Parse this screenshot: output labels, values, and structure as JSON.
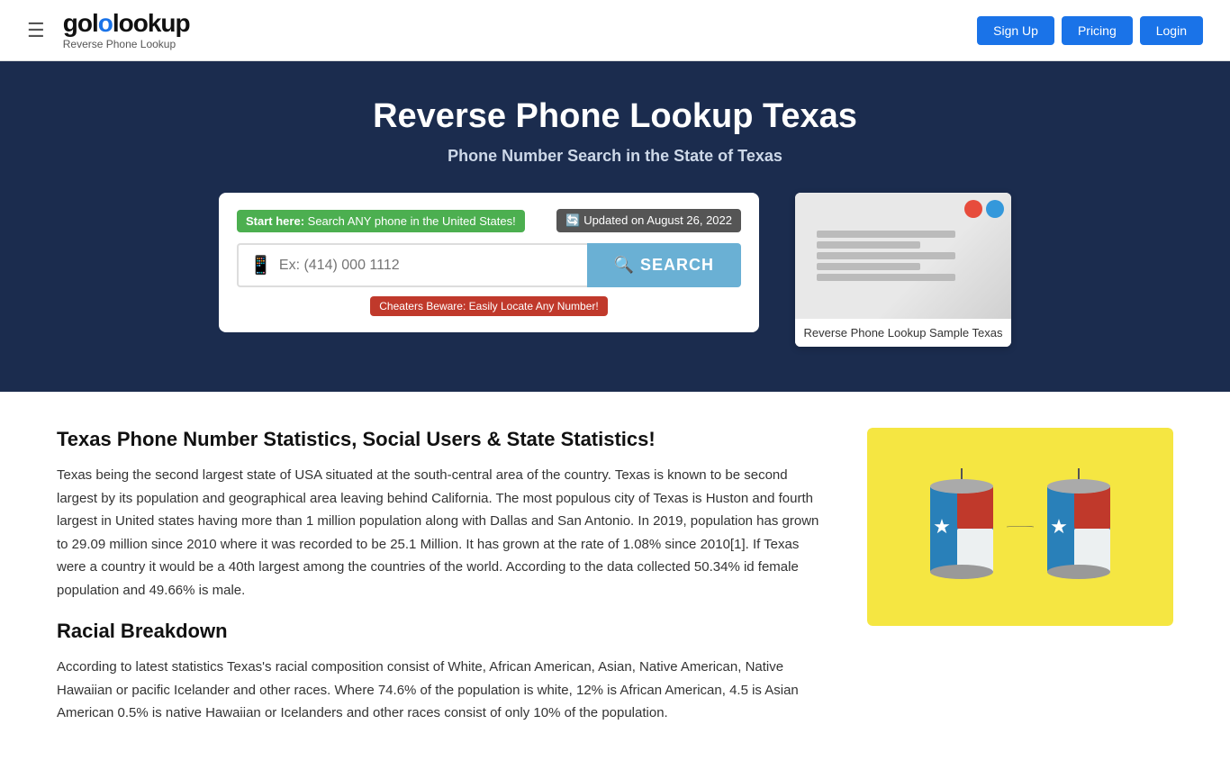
{
  "navbar": {
    "logo_text_go": "go",
    "logo_text_lookup": "lookup",
    "logo_sub": "Reverse Phone Lookup",
    "hamburger_icon": "☰",
    "btn_signup": "Sign Up",
    "btn_pricing": "Pricing",
    "btn_login": "Login"
  },
  "hero": {
    "title": "Reverse Phone Lookup Texas",
    "subtitle": "Phone Number Search in the State of Texas",
    "badge_start_label": "Start here:",
    "badge_start_text": "Search ANY phone in the United States!",
    "badge_updated": "🔄 Updated on August 26, 2022",
    "search_placeholder": "Ex: (414) 000 1112",
    "search_btn": "SEARCH",
    "badge_cheaters": "Cheaters Beware: Easily Locate Any Number!",
    "sample_label": "Reverse Phone Lookup Sample Texas"
  },
  "content": {
    "section1_heading": "Texas Phone Number Statistics, Social Users & State Statistics!",
    "section1_text": "Texas being the second largest state of USA situated at the south-central area of the country. Texas is known to be second largest by its population and geographical area leaving behind California. The most populous city of Texas is Huston and fourth largest in United states having more than 1 million population along with Dallas and San Antonio. In 2019, population has grown to 29.09 million since 2010 where it was recorded to be 25.1 Million. It has grown at the rate of 1.08% since 2010[1]. If Texas were a country it would be a 40th largest among the countries of the world. According to the data collected 50.34% id female population and 49.66% is male.",
    "section2_heading": "Racial Breakdown",
    "section2_text": "According to latest statistics Texas's racial composition consist of White, African American, Asian, Native American, Native Hawaiian or pacific Icelander and other races. Where 74.6% of the population is white, 12% is African American, 4.5 is Asian American 0.5% is native Hawaiian or Icelanders and other races consist of only 10% of the population."
  }
}
